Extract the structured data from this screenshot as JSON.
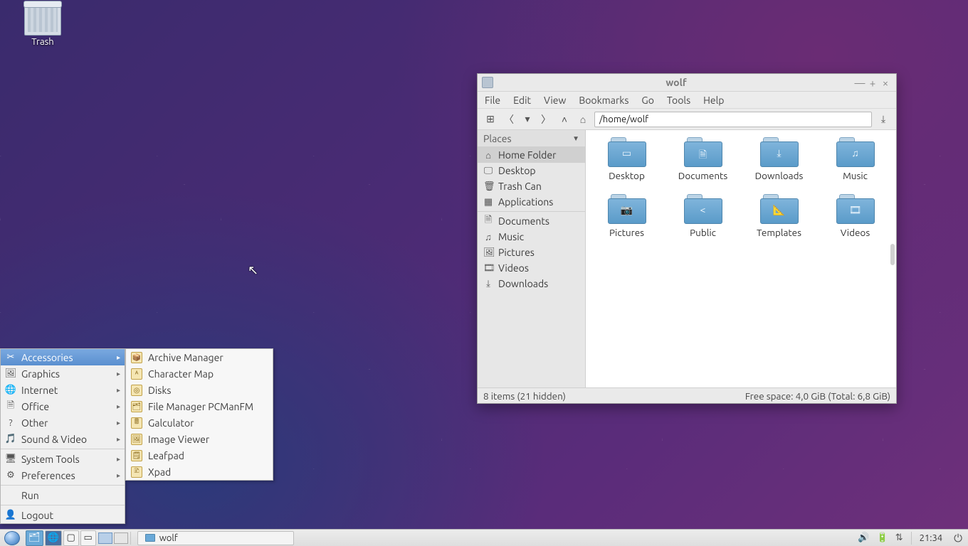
{
  "desktop": {
    "trash_label": "Trash"
  },
  "appmenu": {
    "items": [
      {
        "label": "Accessories",
        "icon": "✂"
      },
      {
        "label": "Graphics",
        "icon": "🖼"
      },
      {
        "label": "Internet",
        "icon": "🌐"
      },
      {
        "label": "Office",
        "icon": "🗎"
      },
      {
        "label": "Other",
        "icon": "?"
      },
      {
        "label": "Sound & Video",
        "icon": "🎵"
      }
    ],
    "items2": [
      {
        "label": "System Tools",
        "icon": "🖥"
      },
      {
        "label": "Preferences",
        "icon": "⚙"
      }
    ],
    "run_label": "Run",
    "logout_label": "Logout"
  },
  "submenu": {
    "items": [
      {
        "label": "Archive Manager",
        "icon": "📦"
      },
      {
        "label": "Character Map",
        "icon": "ᴬ"
      },
      {
        "label": "Disks",
        "icon": "◎"
      },
      {
        "label": "File Manager PCManFM",
        "icon": "🗂"
      },
      {
        "label": "Galculator",
        "icon": "🖩"
      },
      {
        "label": "Image Viewer",
        "icon": "🖼"
      },
      {
        "label": "Leafpad",
        "icon": "🗒"
      },
      {
        "label": "Xpad",
        "icon": "🗈"
      }
    ]
  },
  "fm": {
    "title": "wolf",
    "menus": [
      "File",
      "Edit",
      "View",
      "Bookmarks",
      "Go",
      "Tools",
      "Help"
    ],
    "path": "/home/wolf",
    "sidebar_header": "Places",
    "sidebar_a": [
      {
        "label": "Home Folder",
        "icon": "⌂"
      },
      {
        "label": "Desktop",
        "icon": "🖵"
      },
      {
        "label": "Trash Can",
        "icon": "🗑"
      },
      {
        "label": "Applications",
        "icon": "▦"
      }
    ],
    "sidebar_b": [
      {
        "label": "Documents",
        "icon": "🗎"
      },
      {
        "label": "Music",
        "icon": "♫"
      },
      {
        "label": "Pictures",
        "icon": "🖼"
      },
      {
        "label": "Videos",
        "icon": "🎞"
      },
      {
        "label": "Downloads",
        "icon": "⤓"
      }
    ],
    "folders": [
      {
        "label": "Desktop",
        "glyph": "▭"
      },
      {
        "label": "Documents",
        "glyph": "🗎"
      },
      {
        "label": "Downloads",
        "glyph": "⤓"
      },
      {
        "label": "Music",
        "glyph": "♫"
      },
      {
        "label": "Pictures",
        "glyph": "📷"
      },
      {
        "label": "Public",
        "glyph": "<"
      },
      {
        "label": "Templates",
        "glyph": "📐"
      },
      {
        "label": "Videos",
        "glyph": "🎞"
      }
    ],
    "status_left": "8 items (21 hidden)",
    "status_right": "Free space: 4,0 GiB (Total: 6,8 GiB)"
  },
  "panel": {
    "task_label": "wolf",
    "clock": "21:34"
  }
}
